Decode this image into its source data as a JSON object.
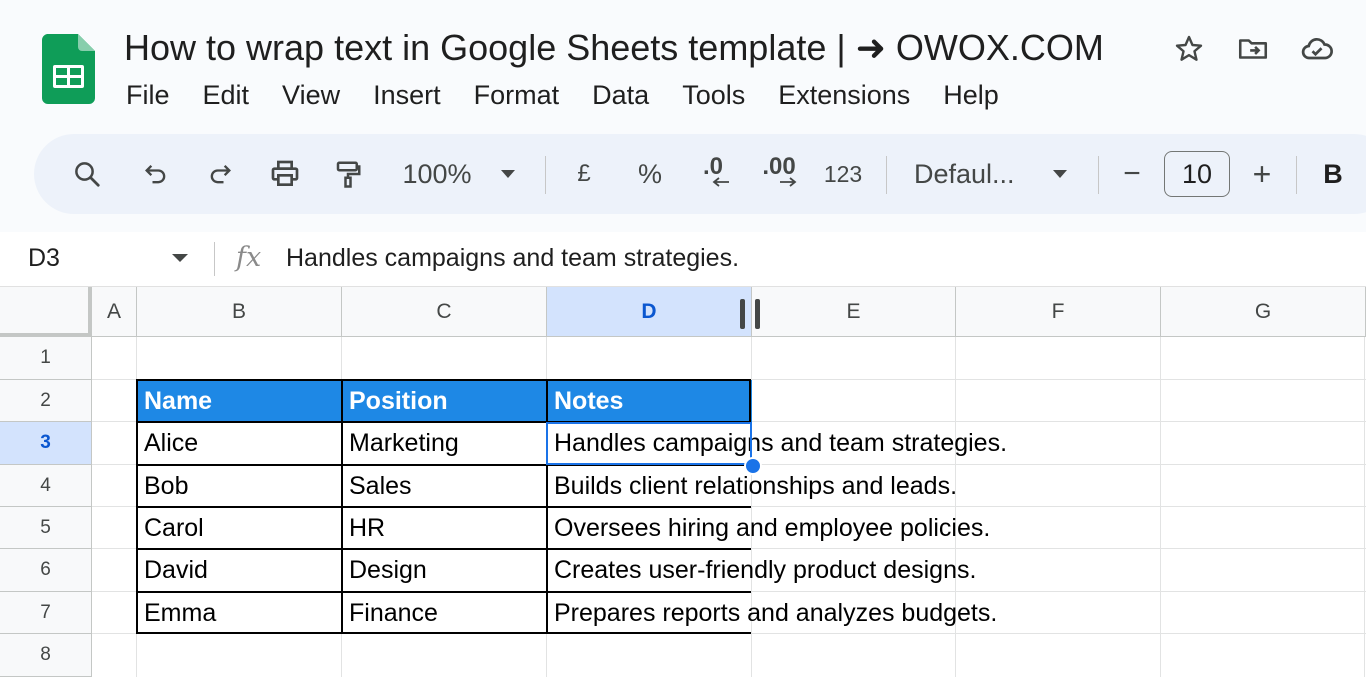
{
  "doc": {
    "title": "How to wrap text in Google Sheets template | ➜ OWOX.COM"
  },
  "menu": [
    "File",
    "Edit",
    "View",
    "Insert",
    "Format",
    "Data",
    "Tools",
    "Extensions",
    "Help"
  ],
  "toolbar": {
    "zoom": "100%",
    "currency": "£",
    "percent": "%",
    "decrease_decimal": ".0",
    "increase_decimal": ".00",
    "number_format": "123",
    "font": "Defaul...",
    "minus": "−",
    "font_size": "10",
    "plus": "+",
    "bold": "B"
  },
  "formula_bar": {
    "cell_ref": "D3",
    "fx": "fx",
    "formula": "Handles campaigns and team strategies."
  },
  "grid": {
    "columns": [
      "A",
      "B",
      "C",
      "D",
      "E",
      "F",
      "G"
    ],
    "rows": [
      "1",
      "2",
      "3",
      "4",
      "5",
      "6",
      "7",
      "8"
    ],
    "selected_column": "D",
    "selected_row": "3",
    "table_headers": [
      "Name",
      "Position",
      "Notes"
    ],
    "table_rows": [
      [
        "Alice",
        "Marketing",
        "Handles campaigns and team strategies."
      ],
      [
        "Bob",
        "Sales",
        "Builds client relationships and leads."
      ],
      [
        "Carol",
        "HR",
        "Oversees hiring and employee policies."
      ],
      [
        "David",
        "Design",
        "Creates user-friendly product designs."
      ],
      [
        "Emma",
        "Finance",
        "Prepares reports and analyzes budgets."
      ]
    ]
  },
  "colors": {
    "header_fill": "#1e88e5",
    "selection": "#1a73e8",
    "selected_header": "#d3e3fd",
    "sheets_green": "#0f9d58"
  }
}
